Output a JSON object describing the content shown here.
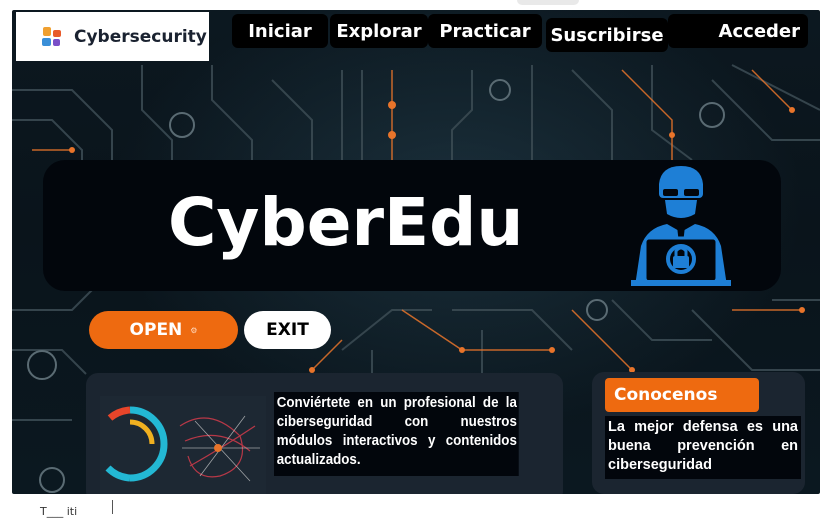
{
  "nav": {
    "logo_text": "Cybersecurity",
    "items": [
      "Iniciar",
      "Explorar",
      "Practicar",
      "Suscribirse",
      "Acceder"
    ]
  },
  "hero": {
    "title": "CyberEdu"
  },
  "actions": {
    "open_label": "OPEN",
    "open_dot": "⚙",
    "exit_label": "EXIT"
  },
  "card_left": {
    "text": "Conviértete en un profesional de la ciberseguridad con nuestros módulos interactivos y contenidos actualizados."
  },
  "card_right": {
    "button_label": "Conocenos",
    "text": "La mejor defensa es una buena prevención en ciberseguridad"
  },
  "below_frame": {
    "text": "T___ iti"
  },
  "colors": {
    "accent_orange": "#ee6a10",
    "hero_bg": "#02060c",
    "circuit_orange": "#e8742a",
    "hacker_blue": "#1e7fd6"
  }
}
